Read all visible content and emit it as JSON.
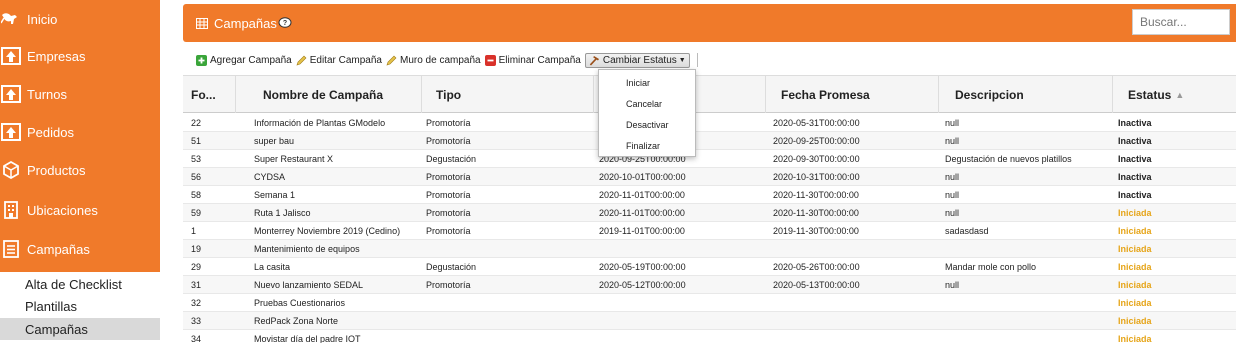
{
  "sidebar": {
    "items": [
      {
        "label": "Inicio",
        "icon": "kangaroo-icon"
      },
      {
        "label": "Empresas",
        "icon": "upload-box-icon"
      },
      {
        "label": "Turnos",
        "icon": "upload-box-icon"
      },
      {
        "label": "Pedidos",
        "icon": "upload-box-icon"
      },
      {
        "label": "Productos",
        "icon": "cube-icon"
      },
      {
        "label": "Ubicaciones",
        "icon": "building-icon"
      },
      {
        "label": "Campañas",
        "icon": "list-icon"
      }
    ],
    "subitems": [
      {
        "label": "Alta de Checklist"
      },
      {
        "label": "Plantillas"
      },
      {
        "label": "Campañas",
        "active": true
      }
    ]
  },
  "header": {
    "title": "Campañas",
    "search_placeholder": "Buscar..."
  },
  "toolbar": {
    "add_label": "Agregar Campaña",
    "edit_label": "Editar Campaña",
    "wall_label": "Muro de campaña",
    "delete_label": "Eliminar Campaña",
    "status_label": "Cambiar Estatus"
  },
  "status_menu": {
    "items": [
      "Iniciar",
      "Cancelar",
      "Desactivar",
      "Finalizar"
    ]
  },
  "table": {
    "columns": [
      "Fo...",
      "Nombre de Campaña",
      "Tipo",
      "",
      "Fecha Promesa",
      "Descripcion",
      "Estatus"
    ],
    "rows": [
      {
        "fo": "22",
        "nombre": "Información de Plantas GModelo",
        "tipo": "Promotoría",
        "fecha": "",
        "promesa": "2020-05-31T00:00:00",
        "desc": "null",
        "estatus": "Inactiva"
      },
      {
        "fo": "51",
        "nombre": "super bau",
        "tipo": "Promotoría",
        "fecha": "",
        "promesa": "2020-09-25T00:00:00",
        "desc": "null",
        "estatus": "Inactiva"
      },
      {
        "fo": "53",
        "nombre": "Super Restaurant X",
        "tipo": "Degustación",
        "fecha": "2020-09-25T00:00:00",
        "promesa": "2020-09-30T00:00:00",
        "desc": "Degustación de nuevos platillos",
        "estatus": "Inactiva"
      },
      {
        "fo": "56",
        "nombre": "CYDSA",
        "tipo": "Promotoría",
        "fecha": "2020-10-01T00:00:00",
        "promesa": "2020-10-31T00:00:00",
        "desc": "null",
        "estatus": "Inactiva"
      },
      {
        "fo": "58",
        "nombre": "Semana 1",
        "tipo": "Promotoría",
        "fecha": "2020-11-01T00:00:00",
        "promesa": "2020-11-30T00:00:00",
        "desc": "null",
        "estatus": "Inactiva"
      },
      {
        "fo": "59",
        "nombre": "Ruta 1 Jalisco",
        "tipo": "Promotoría",
        "fecha": "2020-11-01T00:00:00",
        "promesa": "2020-11-30T00:00:00",
        "desc": "null",
        "estatus": "Iniciada"
      },
      {
        "fo": "1",
        "nombre": "Monterrey Noviembre 2019 (Cedino)",
        "tipo": "Promotoría",
        "fecha": "2019-11-01T00:00:00",
        "promesa": "2019-11-30T00:00:00",
        "desc": "sadasdasd",
        "estatus": "Iniciada"
      },
      {
        "fo": "19",
        "nombre": "Mantenimiento de equipos",
        "tipo": "",
        "fecha": "",
        "promesa": "",
        "desc": "",
        "estatus": "Iniciada"
      },
      {
        "fo": "29",
        "nombre": "La casita",
        "tipo": "Degustación",
        "fecha": "2020-05-19T00:00:00",
        "promesa": "2020-05-26T00:00:00",
        "desc": "Mandar mole con pollo",
        "estatus": "Iniciada"
      },
      {
        "fo": "31",
        "nombre": "Nuevo lanzamiento SEDAL",
        "tipo": "Promotoría",
        "fecha": "2020-05-12T00:00:00",
        "promesa": "2020-05-13T00:00:00",
        "desc": "null",
        "estatus": "Iniciada"
      },
      {
        "fo": "32",
        "nombre": "Pruebas Cuestionarios",
        "tipo": "",
        "fecha": "",
        "promesa": "",
        "desc": "",
        "estatus": "Iniciada"
      },
      {
        "fo": "33",
        "nombre": "RedPack Zona Norte",
        "tipo": "",
        "fecha": "",
        "promesa": "",
        "desc": "",
        "estatus": "Iniciada"
      },
      {
        "fo": "34",
        "nombre": "Movistar día del padre IOT",
        "tipo": "",
        "fecha": "",
        "promesa": "",
        "desc": "",
        "estatus": "Iniciada"
      }
    ]
  },
  "colors": {
    "brand": "#f07a2a",
    "status_iniciada": "#e6a519",
    "status_inactiva": "#222222"
  }
}
